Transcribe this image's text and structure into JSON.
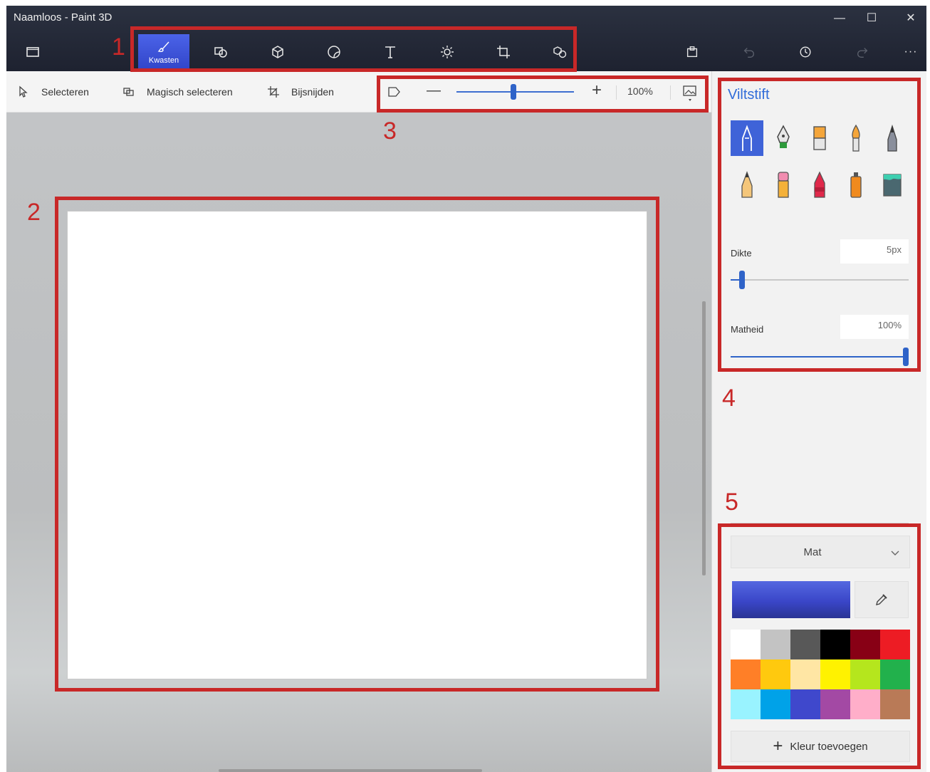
{
  "window": {
    "title": "Naamloos - Paint 3D",
    "controls": [
      "minimize",
      "maximize",
      "close"
    ]
  },
  "tools": [
    {
      "name": "brushes",
      "label": "Kwasten",
      "icon": "brush-icon",
      "active": true
    },
    {
      "name": "2d-shapes",
      "icon": "2d-shapes-icon"
    },
    {
      "name": "3d-shapes",
      "icon": "3d-shapes-icon"
    },
    {
      "name": "stickers",
      "icon": "sticker-icon"
    },
    {
      "name": "text",
      "icon": "text-icon"
    },
    {
      "name": "effects",
      "icon": "effects-icon"
    },
    {
      "name": "canvas",
      "icon": "canvas-icon"
    },
    {
      "name": "3d-library",
      "icon": "3d-library-icon"
    }
  ],
  "right_tools": [
    "paste-icon",
    "undo-icon",
    "history-icon",
    "redo-icon",
    "more-icon"
  ],
  "toolbar2": {
    "select": "Selecteren",
    "magic_select": "Magisch selecteren",
    "crop": "Bijsnijden",
    "zoom_percent": 100,
    "zoom_text": "100%"
  },
  "panel": {
    "title": "Viltstift",
    "brush_names": [
      "marker",
      "calligraphy-pen",
      "oil-brush",
      "watercolor",
      "pixel-pen",
      "pencil",
      "eraser",
      "crayon",
      "spray-can",
      "fill"
    ],
    "selected_brush": 0,
    "thickness_label": "Dikte",
    "thickness_value": "5px",
    "thickness_fraction": 0.05,
    "opacity_label": "Matheid",
    "opacity_value": "100%",
    "opacity_fraction": 1.0,
    "finish": "Mat",
    "current_color": "#3a46c8",
    "palette": [
      "#ffffff",
      "#c3c3c3",
      "#585858",
      "#000000",
      "#880015",
      "#ed1c24",
      "#ff7f27",
      "#ffc90e",
      "#ffe6a4",
      "#fff200",
      "#b5e61d",
      "#22b14c",
      "#99f3ff",
      "#00a2e8",
      "#3f48cc",
      "#a349a4",
      "#ffaec9",
      "#b97a57"
    ],
    "add_color": "Kleur toevoegen"
  },
  "annotations": [
    "1",
    "2",
    "3",
    "4",
    "5"
  ]
}
